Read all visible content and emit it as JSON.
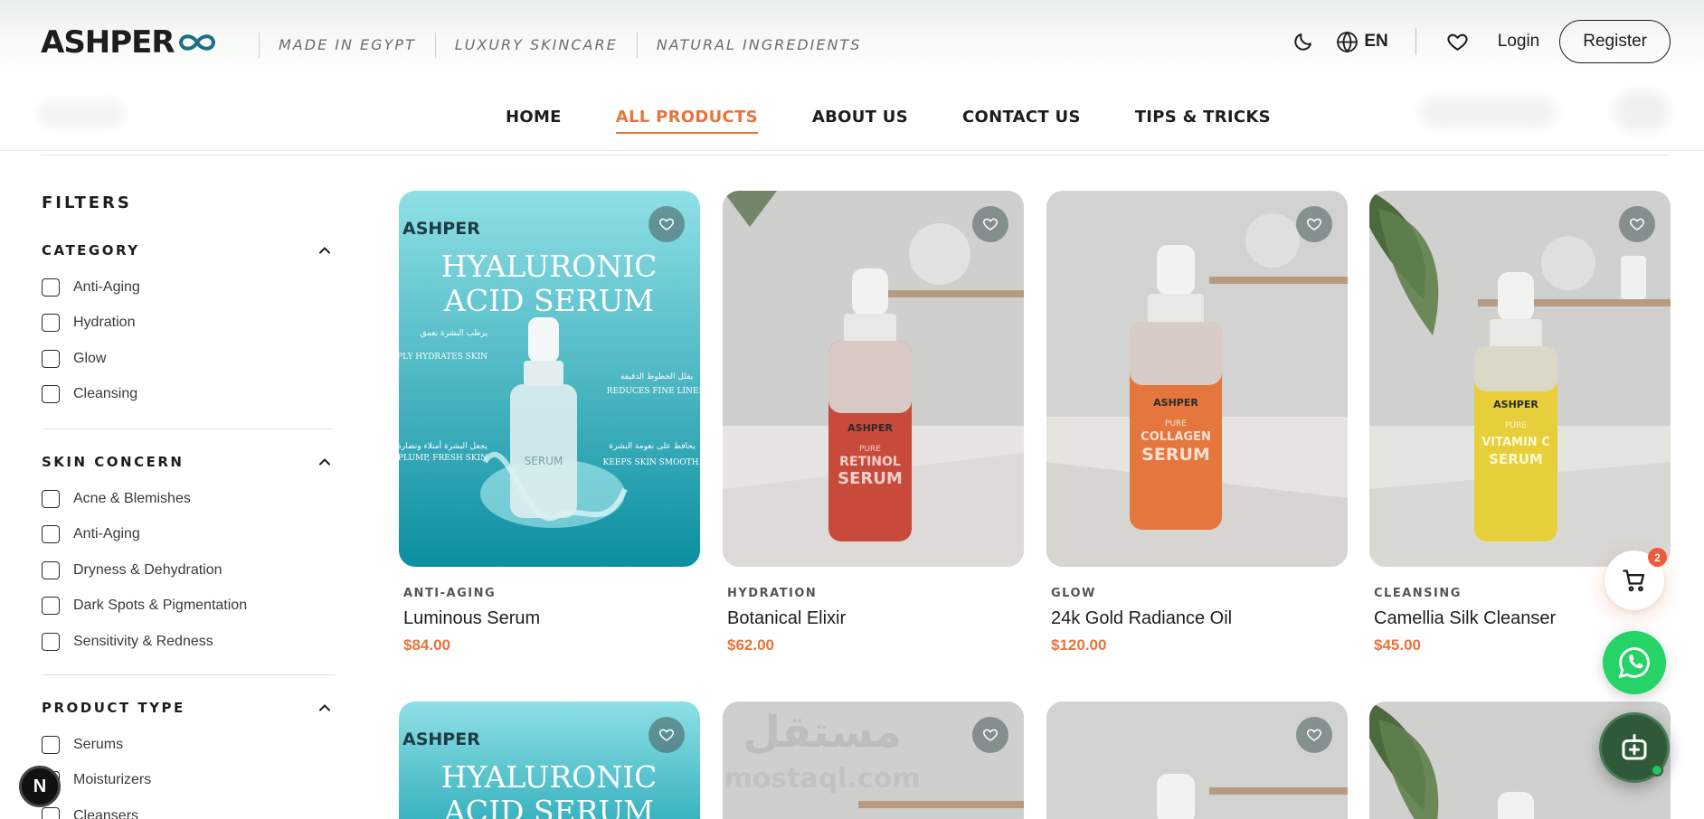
{
  "brand": {
    "logo_text": "ASHPER",
    "taglines": [
      "MADE IN EGYPT",
      "LUXURY SKINCARE",
      "NATURAL INGREDIENTS"
    ]
  },
  "header": {
    "lang": "EN",
    "login": "Login",
    "register": "Register"
  },
  "nav": {
    "items": [
      "HOME",
      "ALL PRODUCTS",
      "ABOUT US",
      "CONTACT US",
      "TIPS & TRICKS"
    ],
    "active": "ALL PRODUCTS"
  },
  "filters": {
    "title": "FILTERS",
    "groups": [
      {
        "title": "CATEGORY",
        "options": [
          "Anti-Aging",
          "Hydration",
          "Glow",
          "Cleansing"
        ]
      },
      {
        "title": "SKIN CONCERN",
        "options": [
          "Acne & Blemishes",
          "Anti-Aging",
          "Dryness & Dehydration",
          "Dark Spots & Pigmentation",
          "Sensitivity & Redness"
        ]
      },
      {
        "title": "PRODUCT TYPE",
        "options": [
          "Serums",
          "Moisturizers",
          "Cleansers"
        ]
      }
    ]
  },
  "products": [
    {
      "category": "ANTI-AGING",
      "name": "Luminous Serum",
      "price": "$84.00",
      "image": "hyaluronic-poster"
    },
    {
      "category": "HYDRATION",
      "name": "Botanical Elixir",
      "price": "$62.00",
      "image": "retinol-serum"
    },
    {
      "category": "GLOW",
      "name": "24k Gold Radiance Oil",
      "price": "$120.00",
      "image": "collagen-serum"
    },
    {
      "category": "CLEANSING",
      "name": "Camellia Silk Cleanser",
      "price": "$45.00",
      "image": "vitamin-c-serum"
    }
  ],
  "product_images": {
    "hyaluronic": {
      "brand": "ASHPER",
      "title_line1": "HYALURONIC",
      "title_line2": "ACID SERUM",
      "bottle_label": "SERUM",
      "callout_1_ar": "يرطب البشرة بعمق",
      "callout_1_en": "DEEPLY HYDRATES SKIN",
      "callout_2_ar": "يقلل الخطوط الدقيقة",
      "callout_2_en": "REDUCES FINE LINES.",
      "callout_3_ar": "يجعل البشرة أمتلاء ونضارة",
      "callout_3_en": "LOOKS PLUMP, FRESH SKIN",
      "callout_4_ar": "يحافظ على نعومة البشرة",
      "callout_4_en": "KEEPS SKIN SMOOTH."
    },
    "retinol": {
      "brand": "ASHPER",
      "line1": "PURE",
      "line2": "RETINOL",
      "line3": "SERUM"
    },
    "collagen": {
      "brand": "ASHPER",
      "line1": "PURE",
      "line2": "COLLAGEN",
      "line3": "SERUM"
    },
    "vitaminc": {
      "brand": "ASHPER",
      "line1": "PURE",
      "line2": "VITAMIN C",
      "line3": "SERUM"
    }
  },
  "watermark": {
    "arabic": "مستقل",
    "latin": "mostaql.com"
  },
  "cart": {
    "count": "2"
  },
  "dev_badge": "N",
  "colors": {
    "accent": "#e8743b",
    "whatsapp": "#25d366",
    "bot": "#2f5a3a"
  }
}
